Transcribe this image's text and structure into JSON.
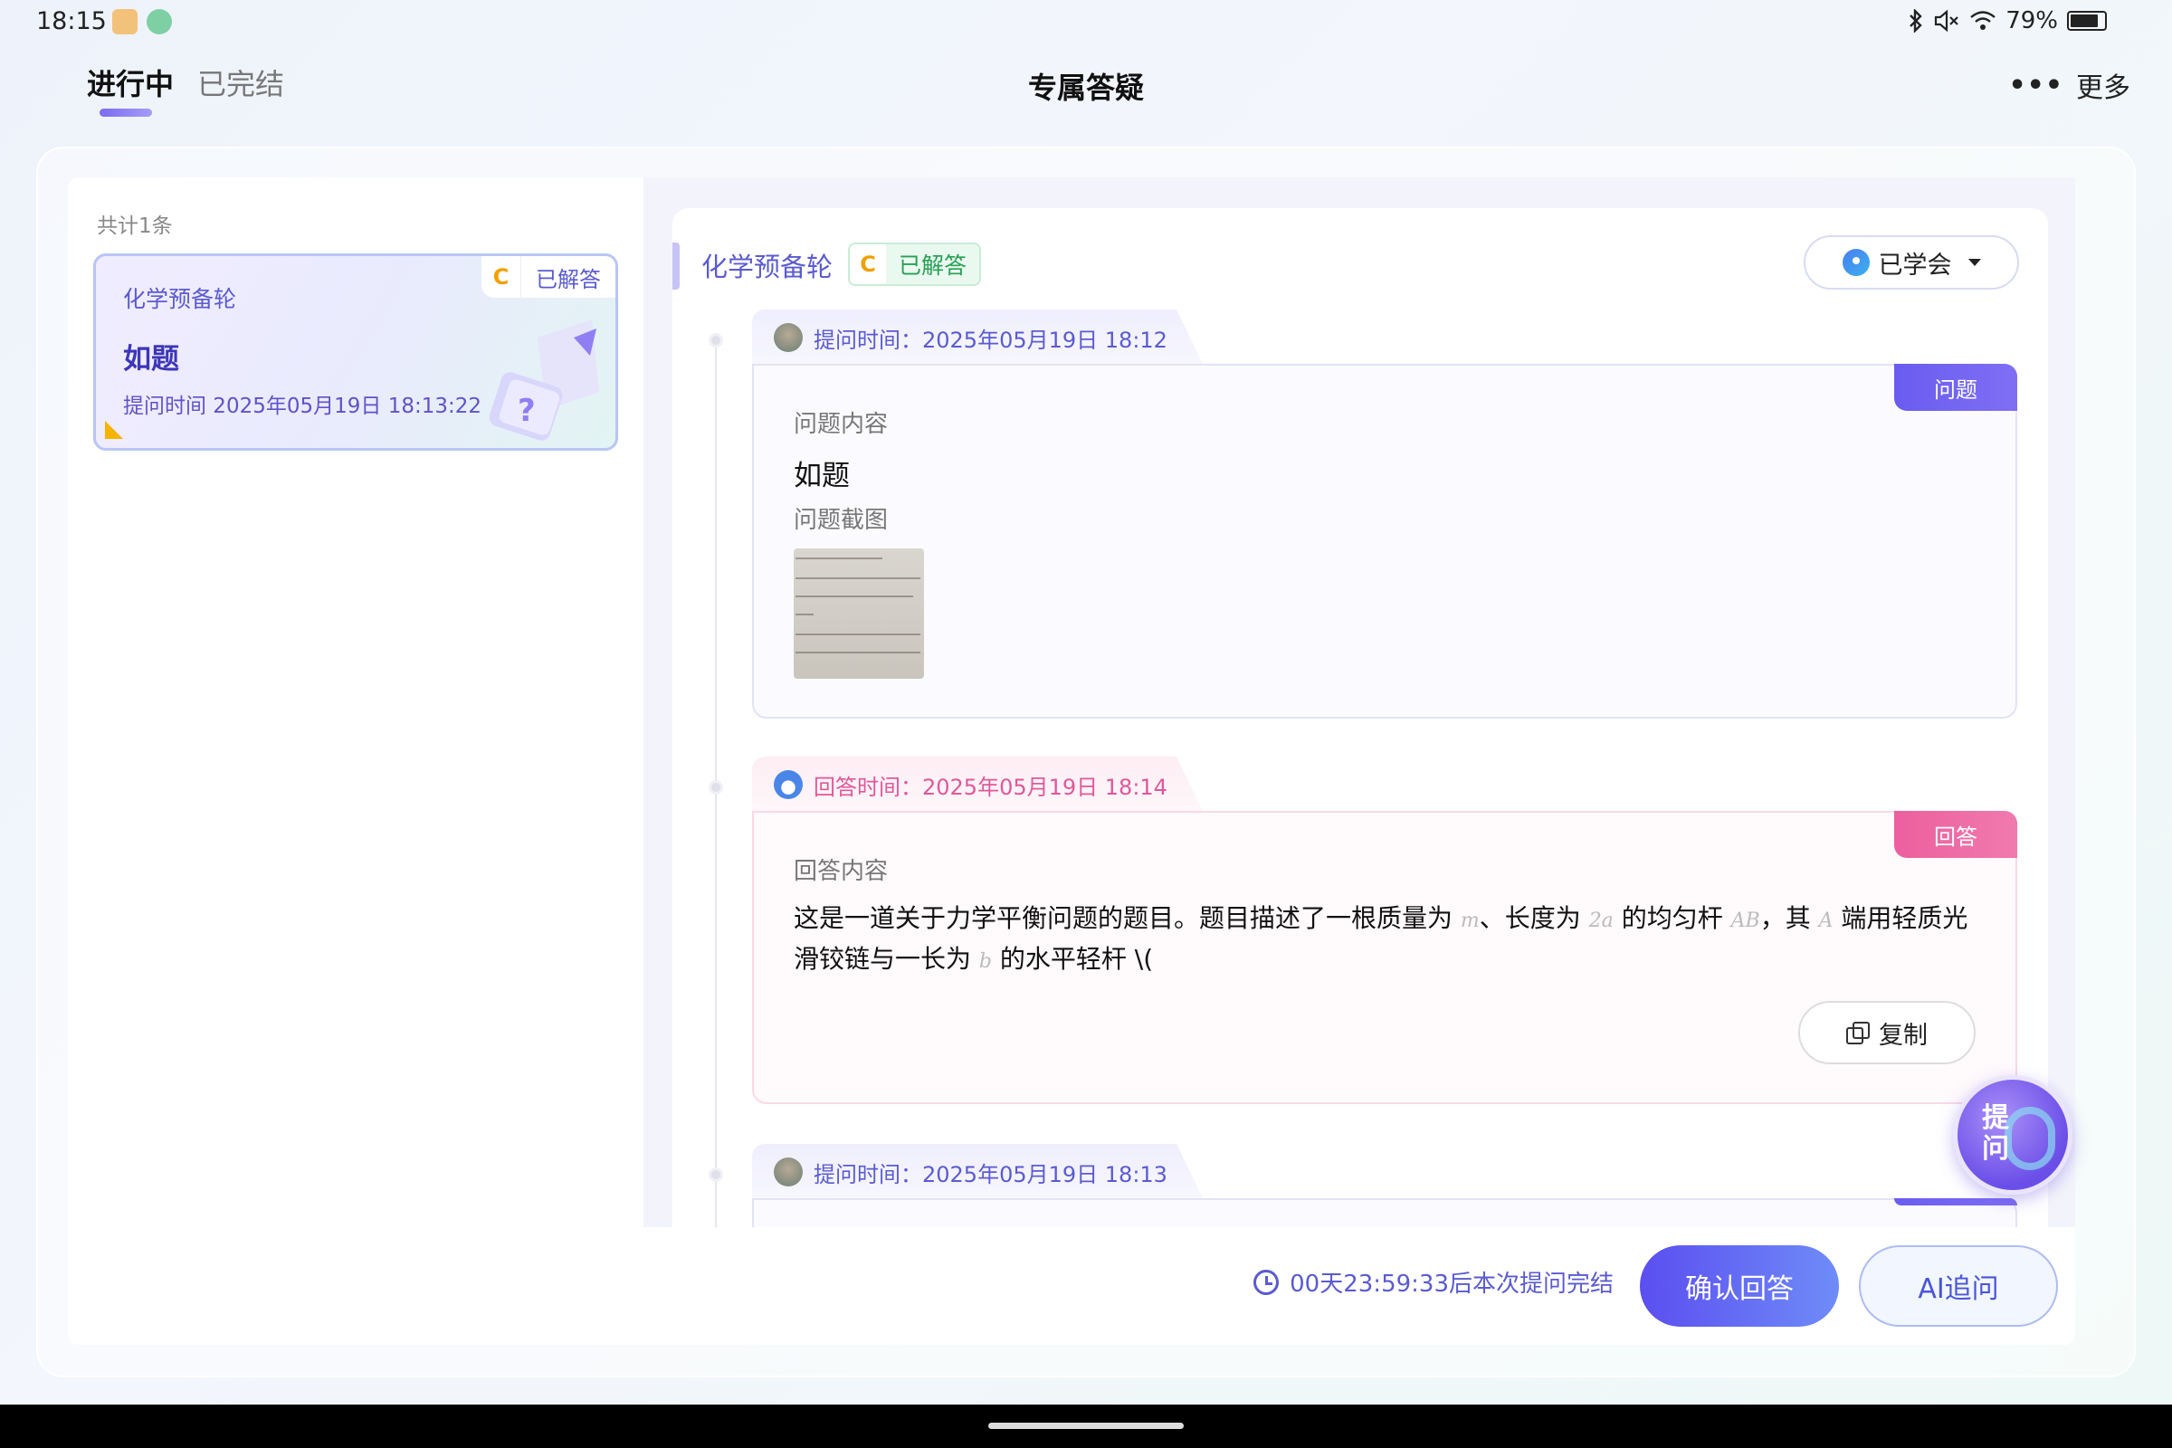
{
  "status_bar": {
    "time": "18:15",
    "battery": "79%",
    "icons": [
      "bluetooth-icon",
      "mute-icon",
      "wifi-icon",
      "battery-icon"
    ]
  },
  "header": {
    "tabs": [
      {
        "label": "进行中",
        "active": true
      },
      {
        "label": "已完结",
        "active": false
      }
    ],
    "title": "专属答疑",
    "more_label": "更多",
    "more_dots": "•••"
  },
  "list": {
    "count": "共计1条",
    "items": [
      {
        "subject": "化学预备轮",
        "tag_letter": "C",
        "tag_label": "已解答",
        "title": "如题",
        "time": "提问时间 2025年05月19日 18:13:22"
      }
    ]
  },
  "detail": {
    "subject": "化学预备轮",
    "tag_letter": "C",
    "tag_label": "已解答",
    "learned_label": "已学会",
    "entries": [
      {
        "type": "question",
        "time_label": "提问时间：2025年05月19日 18:12",
        "badge": "问题",
        "content_label": "问题内容",
        "content": "如题",
        "screenshot_label": "问题截图"
      },
      {
        "type": "answer",
        "time_label": "回答时间：2025年05月19日 18:14",
        "badge": "回答",
        "content_label": "回答内容",
        "content_parts": {
          "p1": "这是一道关于力学平衡问题的题目。题目描述了一根质量为 ",
          "m1": "m",
          "p2": "、长度为 ",
          "m2": "2a",
          "p3": " 的均匀杆 ",
          "m3": "AB",
          "p4": "，其 ",
          "m4": "A",
          "p5": " 端用轻质光滑铰链与一长为 ",
          "m5": "b",
          "p6": " 的水平轻杆 \\("
        },
        "copy_label": "复制"
      },
      {
        "type": "question",
        "time_label": "提问时间：2025年05月19日 18:13"
      }
    ]
  },
  "float_button": {
    "label_line1": "提",
    "label_line2": "问"
  },
  "bottom": {
    "countdown": "00天23:59:33后本次提问完结",
    "confirm_label": "确认回答",
    "ai_label": "AI追问"
  },
  "colors": {
    "accent": "#5b5bd0",
    "question": "#6a5cf0",
    "answer": "#ec5f9e",
    "resolved_green": "#27a055",
    "tag_orange": "#f0a000"
  }
}
